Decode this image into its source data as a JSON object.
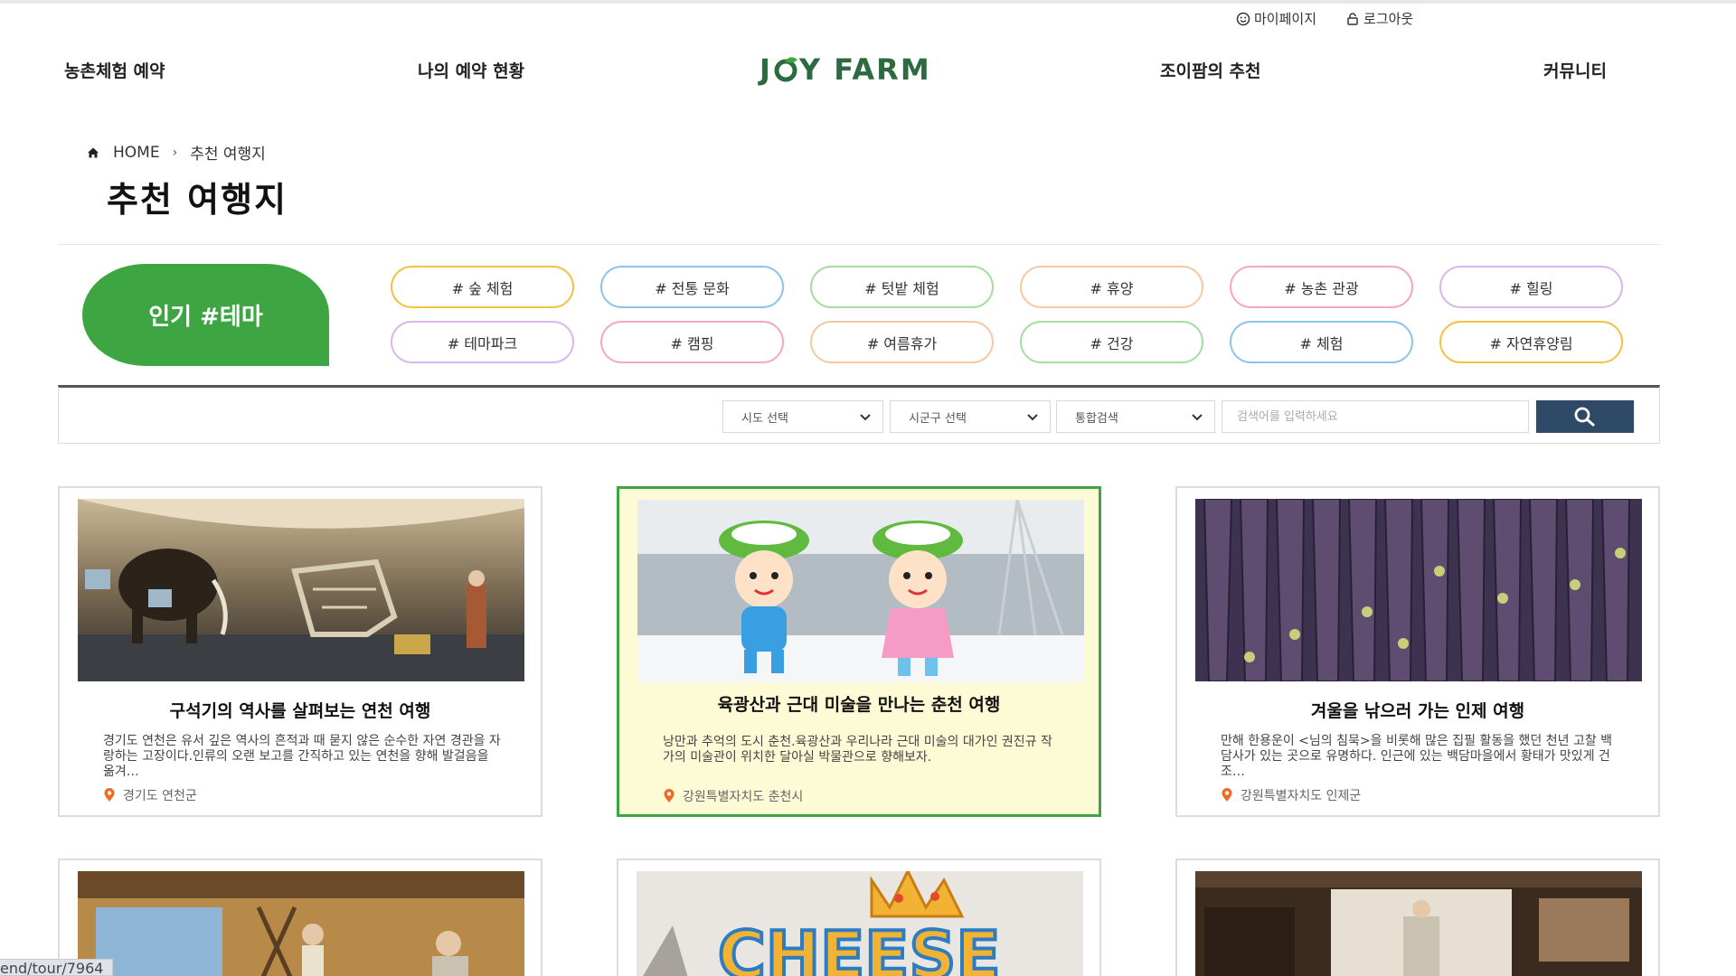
{
  "util": {
    "mypage": "마이페이지",
    "logout": "로그아웃"
  },
  "nav": {
    "items": [
      "농촌체험 예약",
      "나의 예약 현황",
      "조이팜의 추천",
      "커뮤니티"
    ],
    "logo_prefix": "J",
    "logo_suffix": "Y FARM"
  },
  "breadcrumb": {
    "home": "HOME",
    "current": "추천 여행지"
  },
  "page": {
    "title": "추천 여행지"
  },
  "themes": {
    "badge": "인기 #테마",
    "tags": [
      {
        "label": "# 숲 체험",
        "color": "#f5c143"
      },
      {
        "label": "# 전통 문화",
        "color": "#8cc4ea"
      },
      {
        "label": "# 텃밭 체험",
        "color": "#a5dca0"
      },
      {
        "label": "# 휴양",
        "color": "#f6c8a2"
      },
      {
        "label": "# 농촌 관광",
        "color": "#f5a9b8"
      },
      {
        "label": "# 힐링",
        "color": "#d7b8ec"
      },
      {
        "label": "# 테마파크",
        "color": "#d7b8ec"
      },
      {
        "label": "# 캠핑",
        "color": "#f5a9b8"
      },
      {
        "label": "# 여름휴가",
        "color": "#f6c8a2"
      },
      {
        "label": "# 건강",
        "color": "#a5dca0"
      },
      {
        "label": "# 체험",
        "color": "#8cc4ea"
      },
      {
        "label": "# 자연휴양림",
        "color": "#f5c143"
      }
    ]
  },
  "search": {
    "sido": "시도 선택",
    "sigungu": "시군구 선택",
    "type": "통합검색",
    "placeholder": "검색어를 입력하세요"
  },
  "cards": [
    {
      "title": "구석기의 역사를 살펴보는 연천 여행",
      "desc": "경기도 연천은 유서 깊은 역사의 흔적과 때 묻지 않은 순수한 자연 경관을 자랑하는 고장이다.인류의 오랜 보고를 간직하고 있는 연천을 향해 발걸음을 옮겨…",
      "location": "경기도 연천군"
    },
    {
      "title": "육광산과 근대 미술을 만나는 춘천 여행",
      "desc": "낭만과 추억의 도시 춘천.육광산과 우리나라 근대 미술의 대가인 권진규 작가의 미술관이 위치한 달아실 박물관으로 향해보자.",
      "location": "강원특별자치도 춘천시"
    },
    {
      "title": "겨울을 낚으러 가는 인제 여행",
      "desc": "만해 한용운이 <님의 침묵>을 비롯해 많은 집필 활동을 했던 천년 고찰 백담사가 있는 곳으로 유명하다. 인근에 있는 백담마을에서 황태가 맛있게 건조…",
      "location": "강원특별자치도 인제군"
    }
  ],
  "thumb_text": {
    "cheese": "CHEESE"
  },
  "status_bar": {
    "url": "end/tour/7964"
  },
  "colors": {
    "brand_green": "#3da643",
    "logo_green": "#2c6b3f",
    "search_button": "#2f4a66",
    "active_card_bg": "#fdfbd6"
  }
}
